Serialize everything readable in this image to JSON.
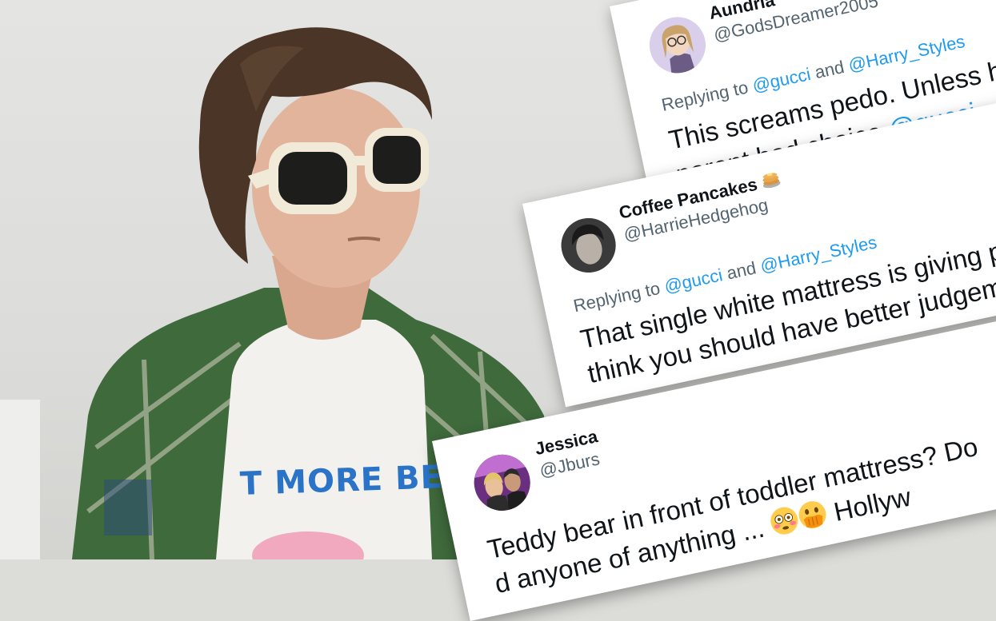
{
  "photo": {
    "shirt_text": "T MORE BER"
  },
  "tweets": [
    {
      "name": "Aundria",
      "handle": "@GodsDreamer2005",
      "reply_prefix": "Replying to ",
      "reply_mention_1": "@gucci",
      "reply_and": " and ",
      "reply_mention_2": "@Harry_Styles",
      "body_line_1": "This screams pedo. Unless h",
      "body_line_2": "parent bad choice ",
      "body_mention": "@gucci"
    },
    {
      "name": "Coffee Pancakes",
      "name_emoji": "pancake-emoji",
      "handle": "@HarrieHedgehog",
      "reply_prefix": "Replying to ",
      "reply_mention_1": "@gucci",
      "reply_and": " and ",
      "reply_mention_2": "@Harry_Styles",
      "body_line_1": "That single white mattress is giving p",
      "body_line_2": "think you should have better judgem"
    },
    {
      "name": "Jessica",
      "handle": "@Jburs",
      "body_line_1": "Teddy bear in front of toddler mattress? Do",
      "body_line_2": "d anyone of anything ... ",
      "body_emoji_1": "flushed-face-emoji",
      "body_emoji_2": "face-with-hand-over-mouth-emoji",
      "body_line_2_end": " Hollyw"
    }
  ]
}
